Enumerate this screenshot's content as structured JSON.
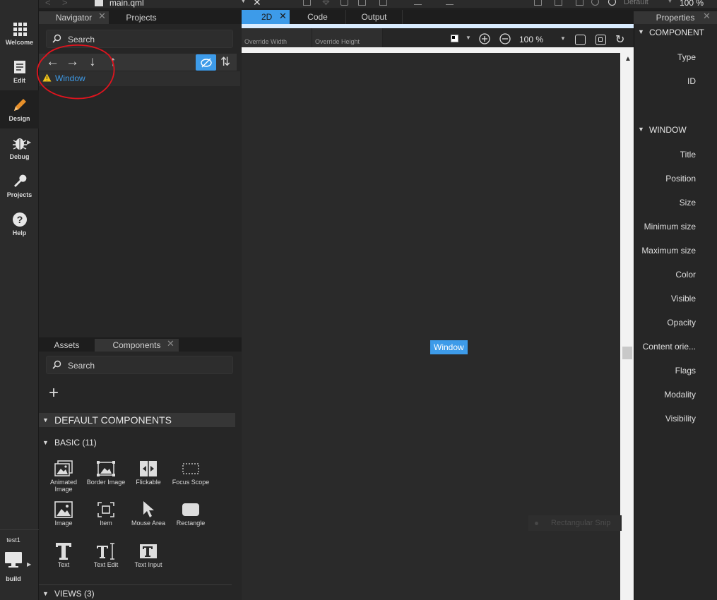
{
  "topbar": {
    "file_name": "main.qml",
    "style_label": "Default",
    "zoom": "100 %"
  },
  "modebar": {
    "items": [
      {
        "label": "Welcome",
        "icon": "grid-icon"
      },
      {
        "label": "Edit",
        "icon": "edit-document-icon"
      },
      {
        "label": "Design",
        "icon": "pencil-icon"
      },
      {
        "label": "Debug",
        "icon": "bug-icon"
      },
      {
        "label": "Projects",
        "icon": "wrench-icon"
      },
      {
        "label": "Help",
        "icon": "help-icon"
      }
    ],
    "project": "test1",
    "build": "build"
  },
  "navigator": {
    "tabs": [
      "Navigator",
      "Projects"
    ],
    "search_placeholder": "Search",
    "tree_item": "Window"
  },
  "components_panel": {
    "tabs": [
      "Assets",
      "Components"
    ],
    "search_placeholder": "Search",
    "add_symbol": "+",
    "default_header": "DEFAULT COMPONENTS",
    "basic_header": "BASIC (11)",
    "views_header": "VIEWS (3)",
    "basic_items": [
      {
        "label": "Animated Image",
        "icon": "animated-image-icon"
      },
      {
        "label": "Border Image",
        "icon": "border-image-icon"
      },
      {
        "label": "Flickable",
        "icon": "flickable-icon"
      },
      {
        "label": "Focus Scope",
        "icon": "focus-scope-icon"
      },
      {
        "label": "Image",
        "icon": "image-icon"
      },
      {
        "label": "Item",
        "icon": "item-icon"
      },
      {
        "label": "Mouse Area",
        "icon": "mouse-area-icon"
      },
      {
        "label": "Rectangle",
        "icon": "rectangle-icon"
      },
      {
        "label": "Text",
        "icon": "text-icon"
      },
      {
        "label": "Text Edit",
        "icon": "text-edit-icon"
      },
      {
        "label": "Text Input",
        "icon": "text-input-icon"
      }
    ]
  },
  "editor": {
    "tabs": [
      "2D",
      "Code",
      "Output"
    ],
    "override_width": "Override Width",
    "override_height": "Override Height",
    "zoom": "100 %",
    "canvas_item": "Window",
    "ghost_tooltip": "Rectangular Snip"
  },
  "properties": {
    "title": "Properties",
    "component_header": "COMPONENT",
    "component_fields": [
      "Type",
      "ID"
    ],
    "window_header": "WINDOW",
    "window_fields": [
      "Title",
      "Position",
      "Size",
      "Minimum size",
      "Maximum size",
      "Color",
      "Visible",
      "Opacity",
      "Content orie...",
      "Flags",
      "Modality",
      "Visibility"
    ]
  },
  "colors": {
    "accent": "#3d9be9",
    "annotation": "#e0141e",
    "warning": "#f0c419"
  }
}
